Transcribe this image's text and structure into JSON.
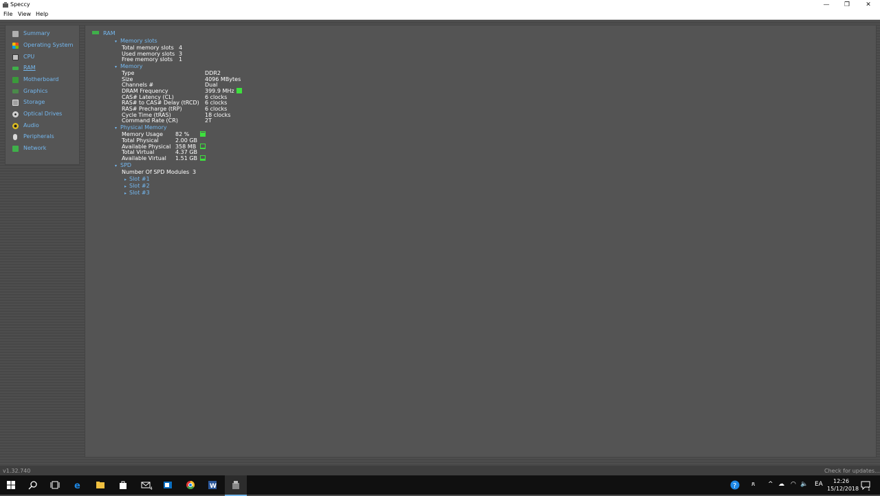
{
  "window": {
    "title": "Speccy",
    "minimize_glyph": "—",
    "restore_glyph": "❐",
    "close_glyph": "✕"
  },
  "menu": [
    "File",
    "View",
    "Help"
  ],
  "sidebar": {
    "items": [
      {
        "label": "Summary",
        "icon": "summary-icon",
        "color": "#b0b0b0"
      },
      {
        "label": "Operating System",
        "icon": "windows-logo-icon",
        "color": "#e8a020"
      },
      {
        "label": "CPU",
        "icon": "cpu-chip-icon",
        "color": "#c0c0c0"
      },
      {
        "label": "RAM",
        "icon": "ram-stick-icon",
        "color": "#3fb04a",
        "active": true
      },
      {
        "label": "Motherboard",
        "icon": "motherboard-icon",
        "color": "#3a9a3a"
      },
      {
        "label": "Graphics",
        "icon": "graphics-card-icon",
        "color": "#4a8a4a"
      },
      {
        "label": "Storage",
        "icon": "hard-drive-icon",
        "color": "#a0a0a0"
      },
      {
        "label": "Optical Drives",
        "icon": "optical-disc-icon",
        "color": "#d0d0d0"
      },
      {
        "label": "Audio",
        "icon": "speaker-icon",
        "color": "#e0c020"
      },
      {
        "label": "Peripherals",
        "icon": "mouse-icon",
        "color": "#d8d8d8"
      },
      {
        "label": "Network",
        "icon": "network-icon",
        "color": "#3fb04a"
      }
    ]
  },
  "content": {
    "section_title": "RAM",
    "memory_slots": {
      "heading": "Memory slots",
      "rows": [
        {
          "label": "Total memory slots",
          "value": "4"
        },
        {
          "label": "Used memory slots",
          "value": "3"
        },
        {
          "label": "Free memory slots",
          "value": "1"
        }
      ]
    },
    "memory": {
      "heading": "Memory",
      "rows": [
        {
          "label": "Type",
          "value": "DDR2"
        },
        {
          "label": "Size",
          "value": "4096 MBytes"
        },
        {
          "label": "Channels #",
          "value": "Dual"
        },
        {
          "label": "DRAM Frequency",
          "value": "399.9 MHz"
        },
        {
          "label": "CAS# Latency (CL)",
          "value": "6 clocks"
        },
        {
          "label": "RAS# to CAS# Delay (tRCD)",
          "value": "6 clocks"
        },
        {
          "label": "RAS# Precharge (tRP)",
          "value": "6 clocks"
        },
        {
          "label": "Cycle Time (tRAS)",
          "value": "18 clocks"
        },
        {
          "label": "Command Rate (CR)",
          "value": "2T"
        }
      ]
    },
    "physical_memory": {
      "heading": "Physical Memory",
      "rows": [
        {
          "label": "Memory Usage",
          "value": "82 %"
        },
        {
          "label": "Total Physical",
          "value": "2.00 GB"
        },
        {
          "label": "Available Physical",
          "value": "358 MB"
        },
        {
          "label": "Total Virtual",
          "value": "4.37 GB"
        },
        {
          "label": "Available Virtual",
          "value": "1.51 GB"
        }
      ]
    },
    "spd": {
      "heading": "SPD",
      "modules_label": "Number Of SPD Modules",
      "modules_value": "3",
      "slots": [
        "Slot #1",
        "Slot #2",
        "Slot #3"
      ]
    }
  },
  "status": {
    "version": "v1.32.740",
    "update_link": "Check for updates..."
  },
  "taskbar": {
    "time": "12:26",
    "date": "15/12/2018",
    "language": "EA",
    "notification_count": "1",
    "mail_badge": "4",
    "apps": [
      "start-windows-icon",
      "search-icon",
      "task-view-icon",
      "edge-browser-icon",
      "file-explorer-icon",
      "store-icon",
      "mail-icon",
      "outlook-icon",
      "chrome-icon",
      "word-icon",
      "speccy-icon"
    ]
  },
  "colors": {
    "accent_link": "#74b8f0",
    "indicator_green": "#3ee03e",
    "content_bg": "#545454",
    "taskbar": "#101010"
  }
}
